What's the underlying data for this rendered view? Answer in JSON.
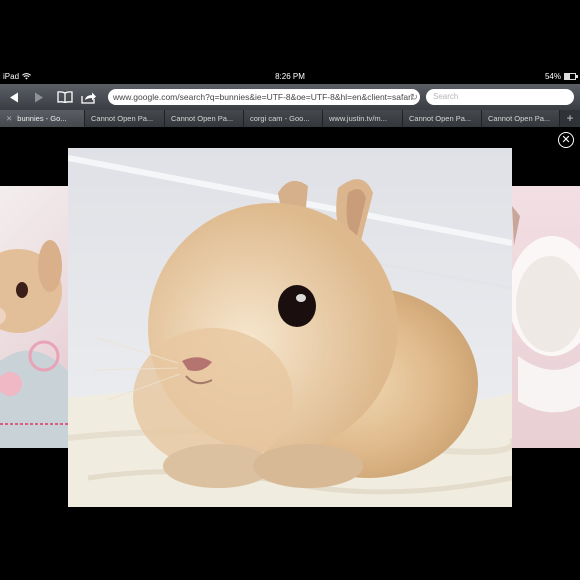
{
  "status": {
    "device": "iPad",
    "time": "8:26 PM",
    "battery": "54%"
  },
  "toolbar": {
    "url": "www.google.com/search?q=bunnies&ie=UTF-8&oe=UTF-8&hl=en&client=safari",
    "search_placeholder": "Search"
  },
  "tabs": [
    {
      "label": "bunnies - Go..."
    },
    {
      "label": "Cannot Open Pa..."
    },
    {
      "label": "Cannot Open Pa..."
    },
    {
      "label": "corgi cam - Goo..."
    },
    {
      "label": "www.justin.tv/m..."
    },
    {
      "label": "Cannot Open Pa..."
    },
    {
      "label": "Cannot Open Pa..."
    }
  ],
  "colors": {
    "toolbar": "#4a4e54",
    "tabbar": "#2f3236",
    "background": "#000000"
  },
  "icons": [
    "wifi-icon",
    "battery-icon",
    "back-icon",
    "forward-icon",
    "bookmarks-icon",
    "share-icon",
    "reload-icon",
    "close-icon",
    "add-tab-icon"
  ]
}
